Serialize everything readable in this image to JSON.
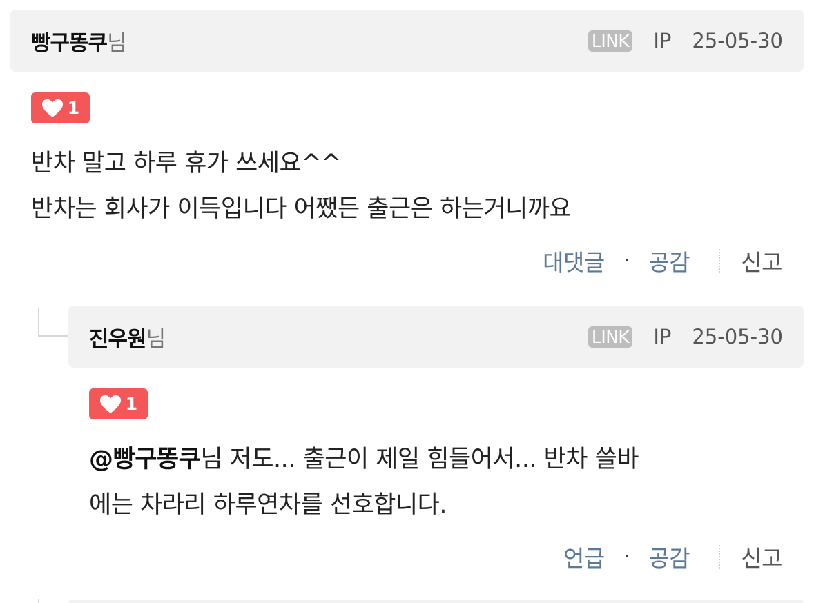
{
  "comments": [
    {
      "author": "빵구똥쿠",
      "honorific": "님",
      "link_badge": "LINK",
      "ip_label": "IP",
      "date": "25-05-30",
      "likes": "1",
      "lines": [
        "반차 말고 하루 휴가 쓰세요^^",
        "반차는 회사가 이득입니다 어쨌든 출근은 하는거니까요"
      ],
      "actions": {
        "reply": "대댓글",
        "dot": "·",
        "like": "공감",
        "report": "신고"
      }
    },
    {
      "author": "진우원",
      "honorific": "님",
      "link_badge": "LINK",
      "ip_label": "IP",
      "date": "25-05-30",
      "likes": "1",
      "mention": "@빵구똥쿠",
      "lines": [
        "님 저도... 출근이 제일 힘들어서... 반차 쓸바",
        "에는 차라리 하루연차를 선호합니다."
      ],
      "actions": {
        "reply": "언급",
        "dot": "·",
        "like": "공감",
        "report": "신고"
      }
    }
  ],
  "colors": {
    "header_bg": "#f2f2f2",
    "like_badge": "#f45757",
    "action_link": "#5b7a99",
    "link_badge": "#bdbdbd"
  },
  "icons": {
    "like": "heart-icon"
  }
}
